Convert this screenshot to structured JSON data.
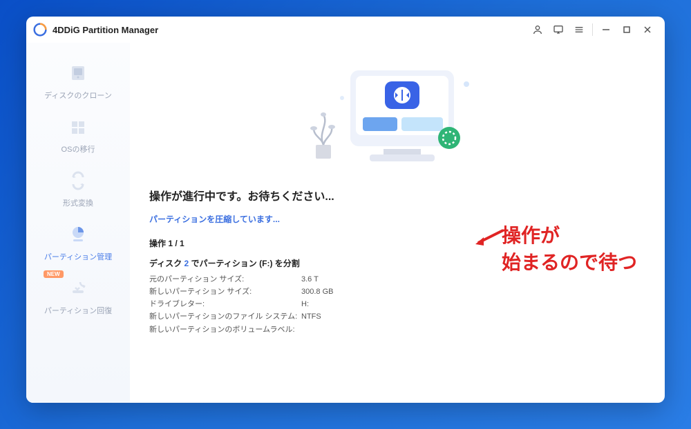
{
  "app": {
    "title": "4DDiG Partition Manager"
  },
  "sidebar": {
    "items": [
      {
        "label": "ディスクのクローン"
      },
      {
        "label": "OSの移行"
      },
      {
        "label": "形式変換"
      },
      {
        "label": "パーティション管理"
      },
      {
        "label": "パーティション回復",
        "badge": "NEW"
      }
    ]
  },
  "main": {
    "heading": "操作が進行中です。お待ちください...",
    "status": "パーティションを圧縮しています...",
    "op_count": "操作 1 / 1",
    "op_title_pre": "ディスク ",
    "op_title_disk": "2",
    "op_title_post": " でパーティション (F:) を分割",
    "details": [
      {
        "label": "元のパーティション サイズ:",
        "value": "3.6 T"
      },
      {
        "label": "新しいパーティション サイズ:",
        "value": "300.8 GB"
      },
      {
        "label": "ドライブレター:",
        "value": "H:"
      },
      {
        "label": "新しいパーティションのファイル システム:",
        "value": "NTFS"
      },
      {
        "label": "新しいパーティションのボリュームラベル:",
        "value": ""
      }
    ]
  },
  "annotation": {
    "line1": "操作が",
    "line2": "始まるので待つ"
  }
}
